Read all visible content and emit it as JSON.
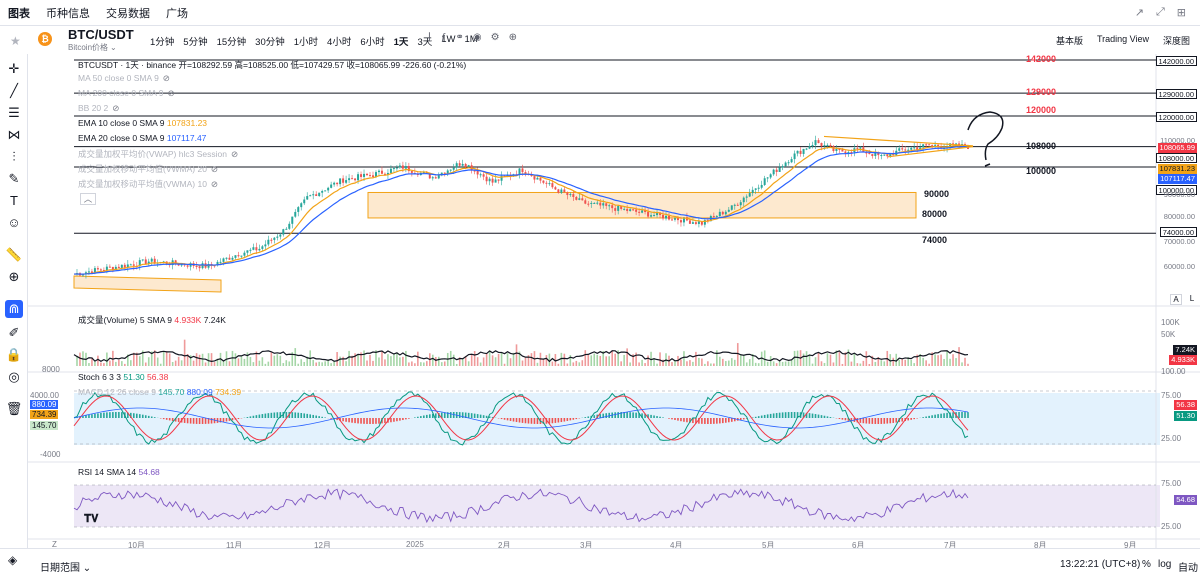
{
  "nav": {
    "tabs": [
      "图表",
      "币种信息",
      "交易数据",
      "广场"
    ],
    "win_icons": [
      "↗",
      "⤢",
      "⊞"
    ]
  },
  "header": {
    "symbol": "BTC/USDT",
    "subtitle": "Bitcoin价格",
    "coin_glyph": "₿",
    "intervals": [
      "1分钟",
      "5分钟",
      "15分钟",
      "30分钟",
      "1小时",
      "4小时",
      "6小时",
      "1天",
      "3天",
      "1W",
      "1M"
    ],
    "active_interval": "1天",
    "views": [
      "基本版",
      "Trading View",
      "深度图"
    ]
  },
  "legends": {
    "ohlc": "BTCUSDT · 1天 · binance  开=108292.59  高=108525.00  低=107429.57  收=108065.99  -226.60 (-0.21%)",
    "ma50": "MA 50 close 0 SMA 9",
    "ma200": "MA 200 close 0 SMA 9",
    "bb": "BB 20 2",
    "ema10_name": "EMA 10 close 0 SMA 9",
    "ema10_val": "107831.23",
    "ema20_name": "EMA 20 close 0 SMA 9",
    "ema20_val": "107117.47",
    "vwap": "成交量加权平均价(VWAP) hlc3 Session",
    "vwma20": "成交量加权移动平均值(VWMA) 20",
    "vwma10": "成交量加权移动平均值(VWMA) 10",
    "volume": "成交量(Volume) 5 SMA 9",
    "volume_v1": "4.933K",
    "volume_v2": "7.24K",
    "stoch": "Stoch 6 3 3",
    "stoch_v1": "51.30",
    "stoch_v2": "56.38",
    "macd": "MACD 12 26 close 9",
    "macd_v1": "145.70",
    "macd_v2": "880.09",
    "macd_v3": "734.39",
    "rsi": "RSI 14 SMA 14",
    "rsi_v": "54.68"
  },
  "annotations": {
    "levels": [
      {
        "label": "142000",
        "color": "#f23645"
      },
      {
        "label": "129000",
        "color": "#f23645"
      },
      {
        "label": "120000",
        "color": "#f23645"
      },
      {
        "label": "108000",
        "color": "#131722"
      },
      {
        "label": "100000",
        "color": "#131722"
      },
      {
        "label": "90000",
        "color": "#131722"
      },
      {
        "label": "80000",
        "color": "#131722"
      },
      {
        "label": "74000",
        "color": "#131722"
      }
    ],
    "question_mark": "?"
  },
  "price_axis": {
    "tags": [
      {
        "text": "142000.00",
        "bg": "#ffffff",
        "fg": "#131722",
        "border": "#131722"
      },
      {
        "text": "129000.00",
        "bg": "#ffffff",
        "fg": "#131722",
        "border": "#131722"
      },
      {
        "text": "120000.00",
        "bg": "#ffffff",
        "fg": "#131722",
        "border": "#131722"
      },
      {
        "text": "110000.00",
        "bg": "none",
        "fg": "#787b86",
        "border": "none"
      },
      {
        "text": "108065.99",
        "bg": "#f23645",
        "fg": "#ffffff",
        "border": "none"
      },
      {
        "text": "108000.00",
        "bg": "#ffffff",
        "fg": "#131722",
        "border": "#131722"
      },
      {
        "text": "107831.23",
        "bg": "#f2a317",
        "fg": "#131722",
        "border": "none"
      },
      {
        "text": "107117.47",
        "bg": "#2962ff",
        "fg": "#ffffff",
        "border": "none"
      },
      {
        "text": "100000.00",
        "bg": "#ffffff",
        "fg": "#131722",
        "border": "#131722"
      },
      {
        "text": "90000.00",
        "bg": "none",
        "fg": "#787b86",
        "border": "none"
      },
      {
        "text": "80000.00",
        "bg": "none",
        "fg": "#787b86",
        "border": "none"
      },
      {
        "text": "74000.00",
        "bg": "#ffffff",
        "fg": "#131722",
        "border": "#131722"
      },
      {
        "text": "70000.00",
        "bg": "none",
        "fg": "#787b86",
        "border": "none"
      },
      {
        "text": "60000.00",
        "bg": "none",
        "fg": "#787b86",
        "border": "none"
      }
    ],
    "auto": "A",
    "log": "L",
    "vol_ticks": [
      "100K",
      "50K"
    ],
    "vol_tags": [
      {
        "text": "7.24K",
        "bg": "#131722",
        "fg": "#ffffff"
      },
      {
        "text": "4.933K",
        "bg": "#f23645",
        "fg": "#ffffff"
      }
    ],
    "osc_ticks": [
      "100.00",
      "75.00",
      "25.00"
    ],
    "osc_tags": [
      {
        "text": "56.38",
        "bg": "#f23645",
        "fg": "#ffffff"
      },
      {
        "text": "51.30",
        "bg": "#089981",
        "fg": "#ffffff"
      }
    ],
    "macd_ticks": [
      "8000",
      "4000.00",
      "-4000"
    ],
    "macd_tags": [
      {
        "text": "880.09",
        "bg": "#2962ff",
        "fg": "#ffffff"
      },
      {
        "text": "734.39",
        "bg": "#f2a317",
        "fg": "#131722"
      },
      {
        "text": "145.70",
        "bg": "#c8e6c9",
        "fg": "#131722"
      }
    ],
    "rsi_ticks": [
      "75.00",
      "25.00"
    ],
    "rsi_tags": [
      {
        "text": "54.68",
        "bg": "#7e57c2",
        "fg": "#ffffff"
      }
    ]
  },
  "time_axis": {
    "ticks": [
      "Z",
      "10月",
      "11月",
      "12月",
      "2025",
      "2月",
      "3月",
      "4月",
      "5月",
      "6月",
      "7月",
      "8月",
      "9月"
    ]
  },
  "bottom": {
    "range": "日期范围",
    "clock": "13:22:21 (UTC+8)",
    "pct": "%",
    "log": "log",
    "auto": "自动"
  },
  "colors": {
    "up": "#26a69a",
    "down": "#ef5350",
    "ema10": "#f2a317",
    "ema20": "#2962ff",
    "zone_fill": "#fde9cf",
    "zone_border": "#f2a317",
    "osc_bg": "#e3f2fd",
    "rsi_bg": "#ede7f6",
    "rsi_line": "#7e57c2"
  }
}
